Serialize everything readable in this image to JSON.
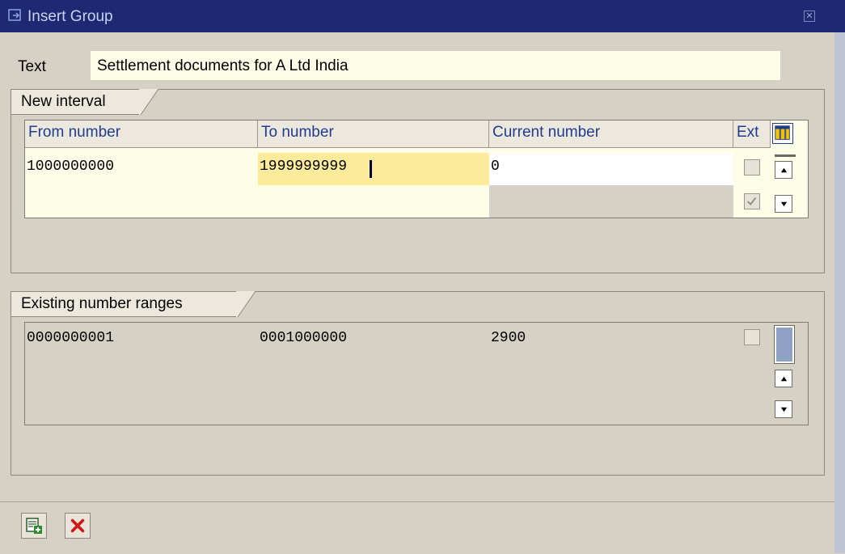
{
  "window": {
    "title": "Insert Group"
  },
  "text_field": {
    "label": "Text",
    "value": "Settlement documents for A Ltd India"
  },
  "new_interval": {
    "group_title": "New interval",
    "columns": {
      "from": "From number",
      "to": "To number",
      "current": "Current number",
      "ext": "Ext"
    },
    "row": {
      "from": "1000000000",
      "to": "1999999999",
      "current": "0"
    }
  },
  "existing_ranges": {
    "group_title": "Existing number ranges",
    "row": {
      "from": "0000000001",
      "to": "0001000000",
      "current": "2900"
    }
  },
  "colors": {
    "title_bar": "#1d2a73",
    "accent_text": "#1f3c8e",
    "focus_field": "#fdeb9c",
    "background": "#d6d1c5"
  }
}
